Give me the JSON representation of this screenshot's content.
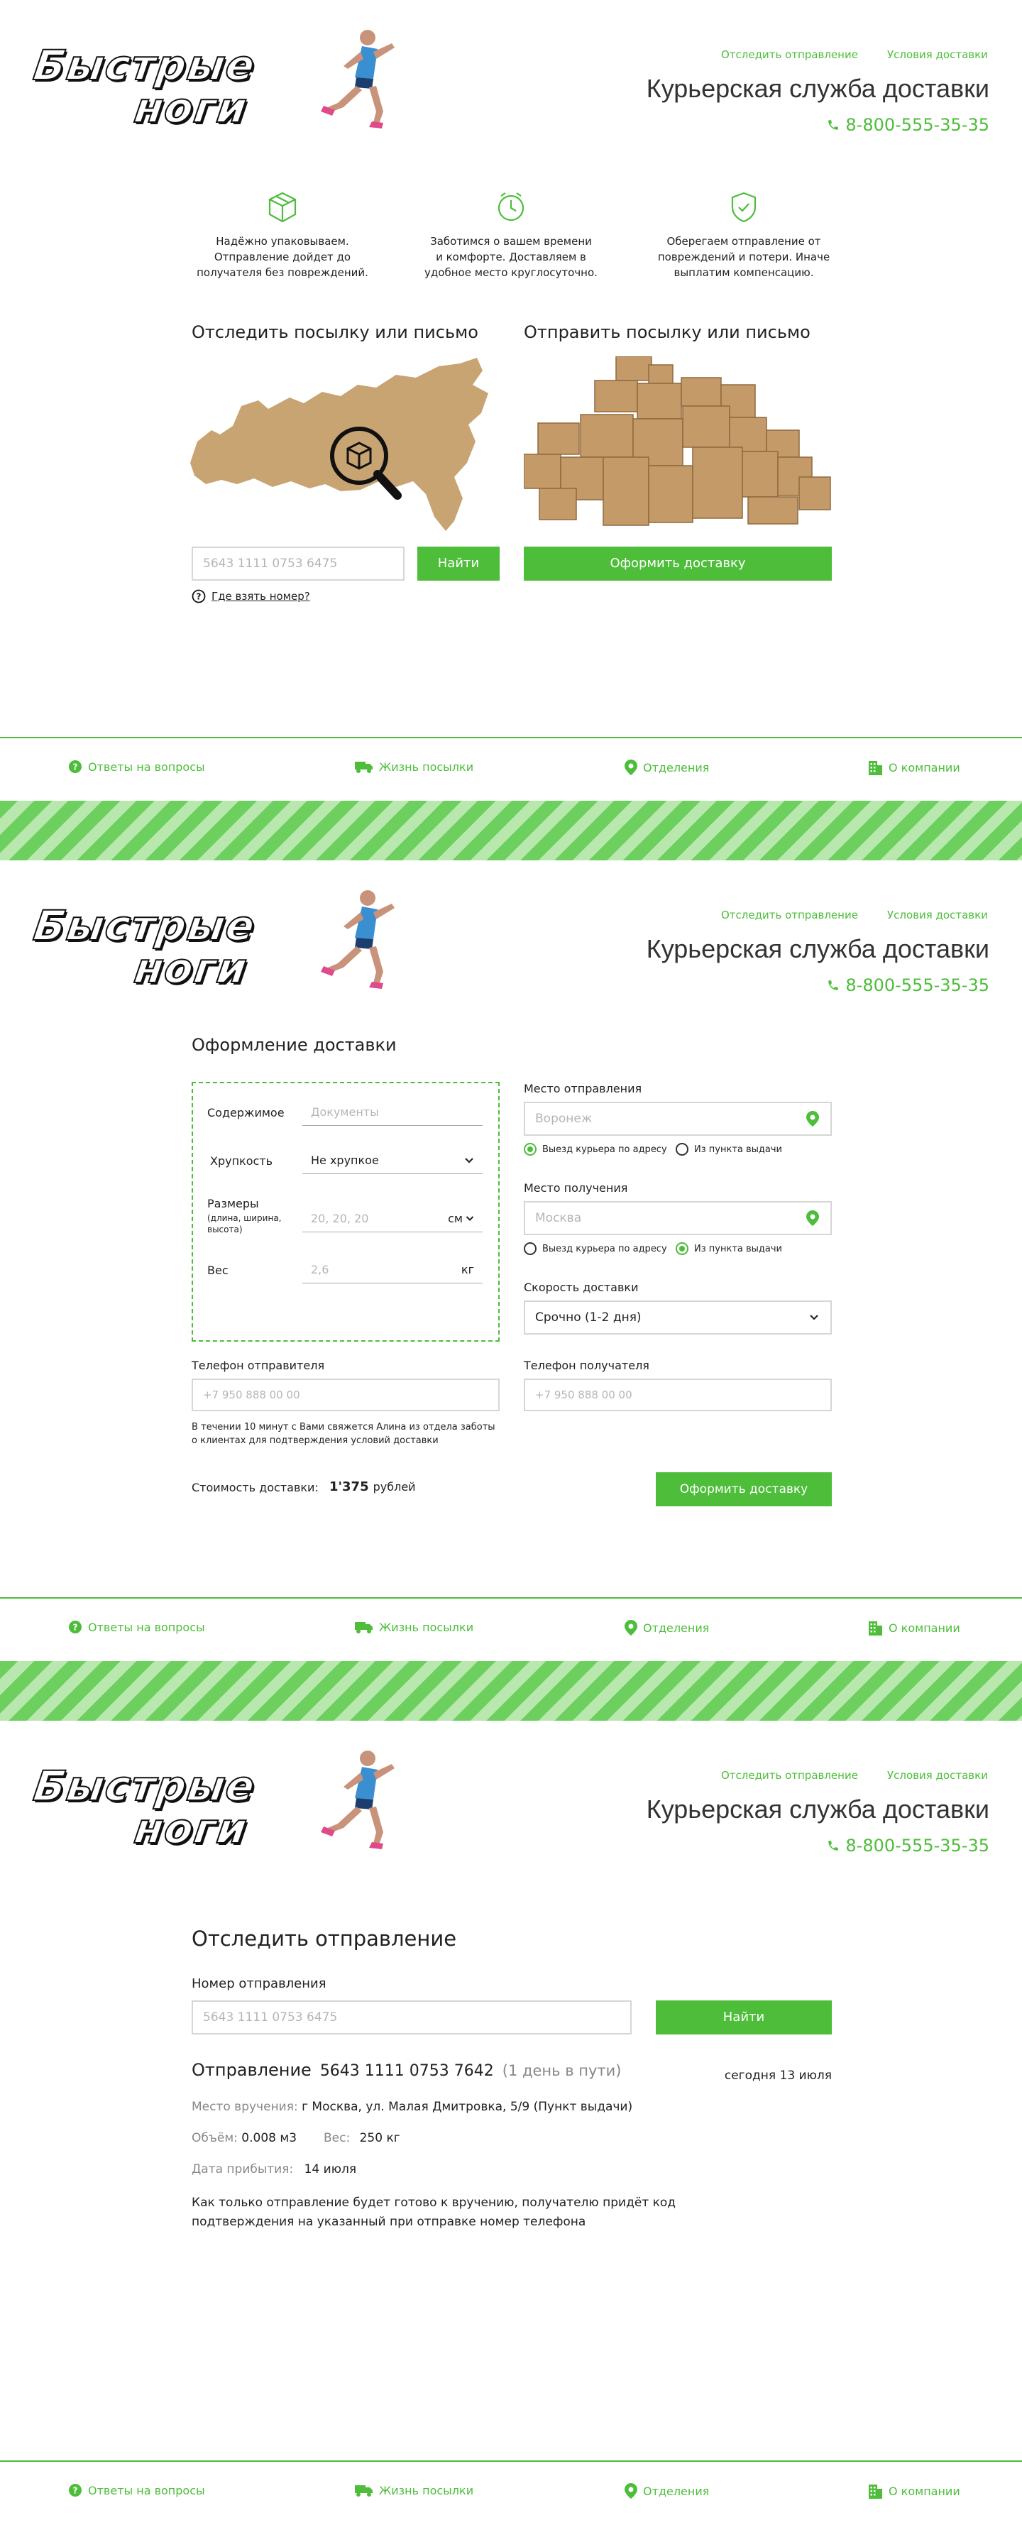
{
  "header": {
    "logo_line1": "Быстрые",
    "logo_line2": "ноги",
    "link_track": "Отследить отправление",
    "link_terms": "Условия доставки",
    "company": "Курьерская служба доставки",
    "phone": "8-800-555-35-35"
  },
  "features": [
    {
      "icon": "box-icon",
      "text_l1": "Надёжно упаковываем.",
      "text_l2": "Отправление дойдет до",
      "text_l3": "получателя без повреждений."
    },
    {
      "icon": "clock-icon",
      "text_l1": "Заботимся о вашем времени",
      "text_l2": "и комфорте. Доставляем в",
      "text_l3": "удобное место круглосуточно."
    },
    {
      "icon": "shield-icon",
      "text_l1": "Оберегаем отправление от",
      "text_l2": "повреждений и потери. Иначе",
      "text_l3": "выплатим компенсацию."
    }
  ],
  "home": {
    "track_title": "Отследить посылку или письмо",
    "send_title": "Отправить посылку или письмо",
    "track_placeholder": "5643 1111 0753 6475",
    "find_button": "Найти",
    "where_number": "Где взять номер?",
    "order_button": "Оформить доставку"
  },
  "footer": {
    "faq": "Ответы на вопросы",
    "life": "Жизнь посылки",
    "branches": "Отделения",
    "about": "О компании"
  },
  "order": {
    "title": "Оформление доставки",
    "content_label": "Содержимое",
    "content_placeholder": "Документы",
    "fragility_label": "Хрупкость",
    "fragility_value": "Не хрупкое",
    "size_label": "Размеры",
    "size_hint": "(длина, ширина, высота)",
    "size_placeholder": "20, 20, 20",
    "size_unit": "см",
    "weight_label": "Вес",
    "weight_placeholder": "2,6",
    "weight_unit": "кг",
    "from_label": "Место отправления",
    "from_placeholder": "Воронеж",
    "courier_option": "Выезд курьера по адресу",
    "pickup_option": "Из пункта выдачи",
    "to_label": "Место получения",
    "to_placeholder": "Москва",
    "speed_label": "Скорость доставки",
    "speed_value": "Срочно (1-2 дня)",
    "sender_phone_label": "Телефон отправителя",
    "sender_phone_placeholder": "+7 950 888 00 00",
    "receiver_phone_label": "Телефон получателя",
    "receiver_phone_placeholder": "+7 950 888 00 00",
    "note": "В течении 10 минут с Вами свяжется Алина из отдела заботы о клиентах для подтверждения условий доставки",
    "cost_label": "Стоимость доставки:",
    "cost_value": "1'375",
    "cost_unit": "рублей",
    "submit": "Оформить доставку"
  },
  "tracking": {
    "title": "Отследить отправление",
    "number_label": "Номер отправления",
    "number_placeholder": "5643 1111 0753 6475",
    "find_button": "Найти",
    "shipment_label": "Отправление",
    "shipment_number": "5643 1111 0753 7642",
    "shipment_status": "(1 день в пути)",
    "today": "сегодня 13 июля",
    "place_label": "Место вручения:",
    "place_value": "г Москва, ул. Малая Дмитровка, 5/9 (Пункт выдачи)",
    "volume_label": "Объём:",
    "volume_value": "0.008 м3",
    "weight_label": "Вес:",
    "weight_value": "250 кг",
    "arrival_label": "Дата прибытия:",
    "arrival_value": "14 июля",
    "info_l1": "Как только отправление будет готово к вручению, получателю придёт код",
    "info_l2": "подтверждения на указанный при отправке номер телефона"
  },
  "colors": {
    "accent": "#4dbd3a",
    "map": "#c9a473",
    "box": "#c49a68"
  }
}
